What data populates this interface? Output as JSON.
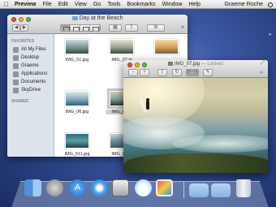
{
  "menubar": {
    "items": [
      "Preview",
      "File",
      "Edit",
      "View",
      "Go",
      "Tools",
      "Bookmarks",
      "Window",
      "Help"
    ],
    "user": "Graeme Roche"
  },
  "finder": {
    "title": "Day at the Beach",
    "sidebar": {
      "favorites_header": "FAVORITES",
      "items": [
        {
          "label": "All My Files",
          "icon": "all-files-icon"
        },
        {
          "label": "Desktop",
          "icon": "desktop-icon"
        },
        {
          "label": "Graeme",
          "icon": "home-icon"
        },
        {
          "label": "Applications",
          "icon": "applications-icon"
        },
        {
          "label": "Documents",
          "icon": "documents-icon"
        },
        {
          "label": "SkyDrive",
          "icon": "skydrive-icon"
        }
      ],
      "shared_header": "SHARED"
    },
    "files": [
      {
        "name": "IMG_01.jpg",
        "selected": false
      },
      {
        "name": "IMG_02.jp",
        "selected": false
      },
      {
        "name": "",
        "selected": false
      },
      {
        "name": "IMG_06.jpg",
        "selected": false
      },
      {
        "name": "IMG_07.jp",
        "selected": true
      },
      {
        "name": "IMG_011.jpg",
        "selected": false
      },
      {
        "name": "IMG_012.j",
        "selected": false
      }
    ]
  },
  "preview": {
    "title": "IMG_07.jpg",
    "locked_label": "— Locked"
  },
  "dock": {
    "icons": [
      "finder-icon",
      "launchpad-icon",
      "app-store-icon",
      "safari-icon",
      "preview-icon",
      "icloud-icon",
      "photos-icon",
      "folder-icon",
      "downloads-folder-icon",
      "trash-icon"
    ]
  }
}
